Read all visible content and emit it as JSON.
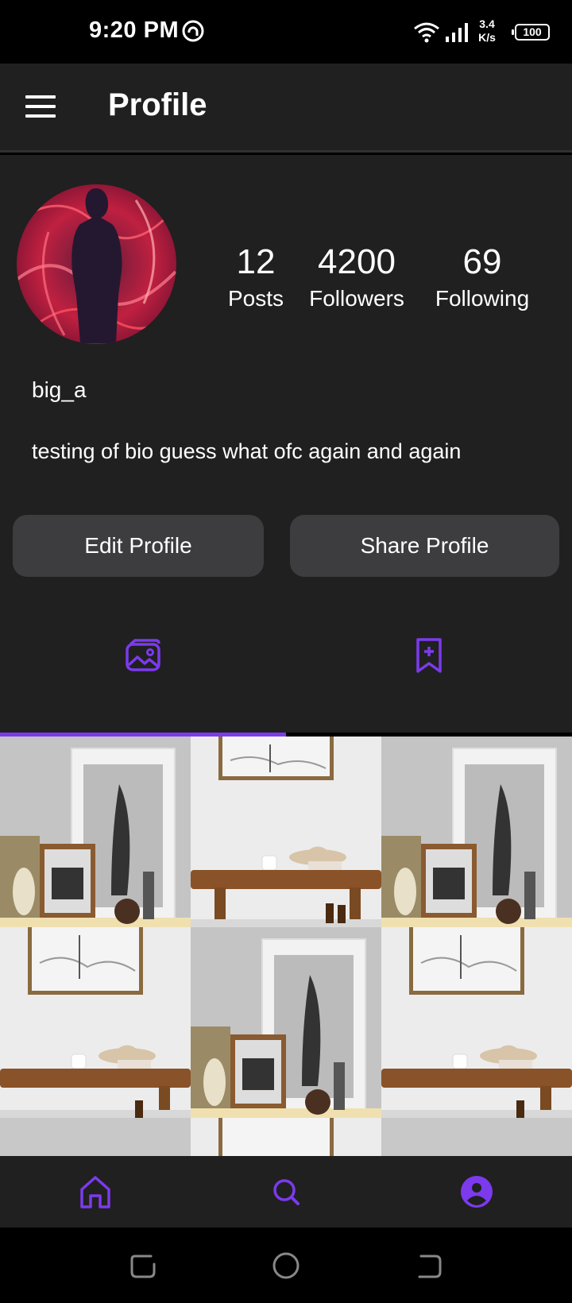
{
  "status_bar": {
    "time": "9:20 PM",
    "net_speed_value": "3.4",
    "net_speed_unit": "K/s",
    "battery": "100"
  },
  "app_bar": {
    "title": "Profile",
    "menu_icon": "hamburger-menu-icon"
  },
  "profile": {
    "username": "big_a",
    "bio": "testing of bio guess what ofc again and again",
    "stats": [
      {
        "value": "12",
        "label": "Posts"
      },
      {
        "value": "4200",
        "label": "Followers"
      },
      {
        "value": "69",
        "label": "Following"
      }
    ],
    "edit_button": "Edit Profile",
    "share_button": "Share Profile"
  },
  "tabs": [
    {
      "icon": "gallery-icon",
      "selected": true
    },
    {
      "icon": "bookmark-add-icon",
      "selected": false
    }
  ],
  "bottom_nav": [
    {
      "icon": "home-icon"
    },
    {
      "icon": "search-icon"
    },
    {
      "icon": "profile-icon",
      "selected": true
    }
  ],
  "colors": {
    "accent": "#7c3aed",
    "surface": "#202020",
    "button": "#3d3d3f"
  }
}
